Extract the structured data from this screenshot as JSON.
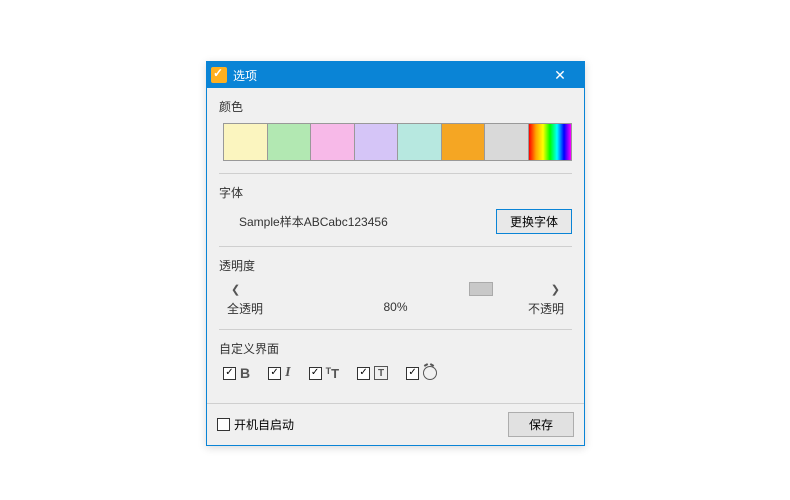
{
  "window": {
    "title": "选项"
  },
  "colors": {
    "label": "颜色",
    "swatches": [
      "#FBF5BF",
      "#B2E8B2",
      "#F7B9E8",
      "#D5C5F7",
      "#B7E8E0",
      "#F5A623",
      "#D9D9D9",
      "rainbow"
    ]
  },
  "font": {
    "label": "字体",
    "sample": "Sample样本ABCabc123456",
    "change_btn": "更换字体"
  },
  "opacity": {
    "label": "透明度",
    "min_label": "全透明",
    "value_label": "80%",
    "max_label": "不透明",
    "value": 80
  },
  "custom": {
    "label": "自定义界面",
    "items": [
      {
        "checked": true,
        "glyph": "B"
      },
      {
        "checked": true,
        "glyph": "I"
      },
      {
        "checked": true,
        "glyph": "T"
      },
      {
        "checked": true,
        "glyph": "T"
      },
      {
        "checked": true,
        "glyph": "clock"
      }
    ]
  },
  "footer": {
    "autostart_checked": false,
    "autostart_label": "开机自启动",
    "save_btn": "保存"
  }
}
